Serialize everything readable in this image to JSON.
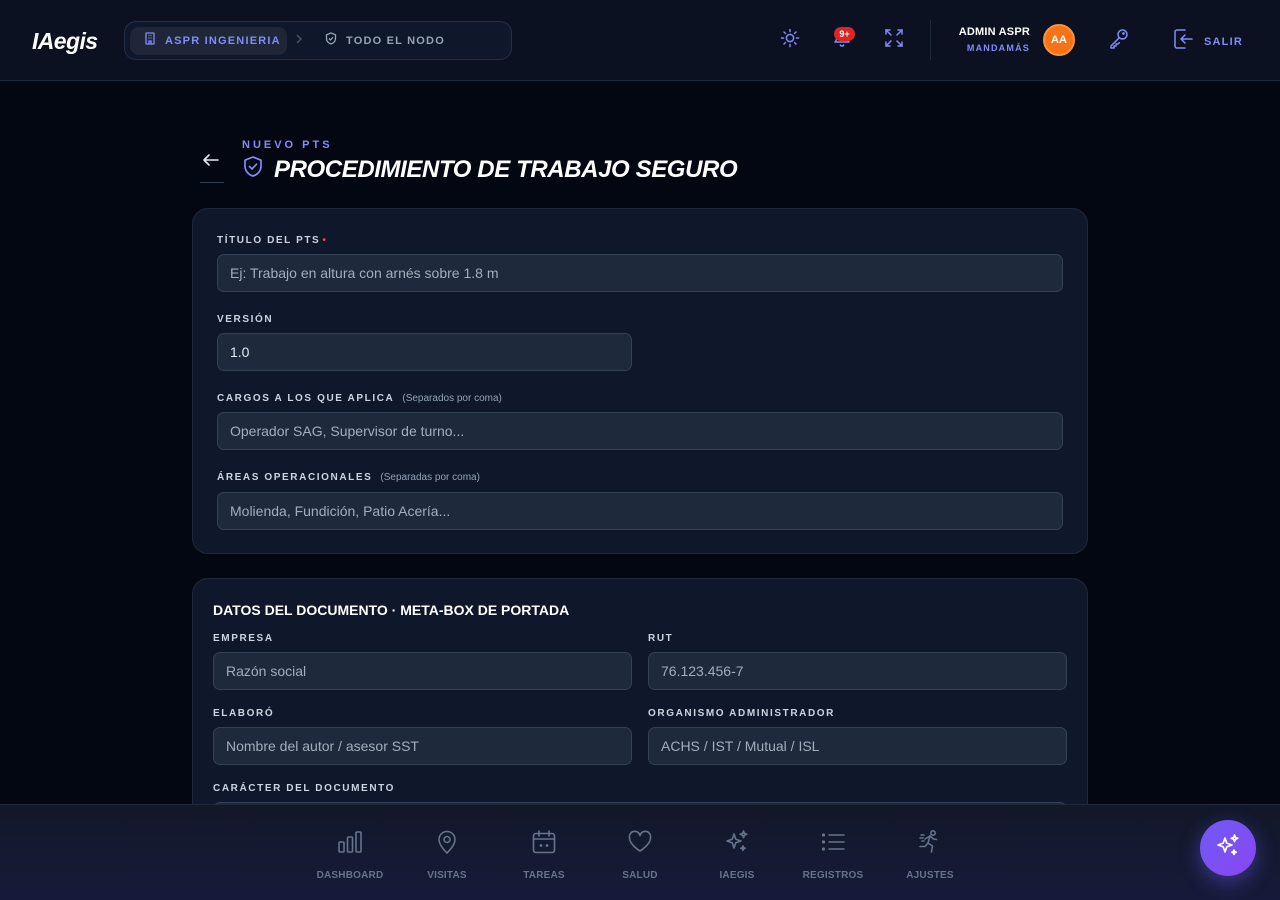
{
  "colors": {
    "accent": "#818cf8",
    "avatar_bg": "#f97316",
    "badge_bg": "#dc2626",
    "required": "#ef4444",
    "fab": "#7c4dfb"
  },
  "header": {
    "logo": "IAegis",
    "breadcrumb": {
      "active": "ASPR INGENIERIA",
      "active_icon": "building-icon",
      "secondary": "TODO EL NODO",
      "secondary_icon": "shield-icon"
    },
    "notifications_badge": "9+",
    "user": {
      "name": "ADMIN ASPR",
      "role": "MANDAMÁS",
      "initials": "AA"
    },
    "logout_label": "SALIR"
  },
  "page": {
    "eyebrow": "NUEVO PTS",
    "title": "PROCEDIMIENTO DE TRABAJO SEGURO"
  },
  "form": {
    "titulo": {
      "label": "TÍTULO DEL PTS",
      "required_mark": "•",
      "placeholder": "Ej: Trabajo en altura con arnés sobre 1.8 m"
    },
    "version": {
      "label": "VERSIÓN",
      "value": "1.0"
    },
    "cargos": {
      "label": "CARGOS A LOS QUE APLICA",
      "hint": "(Separados por coma)",
      "placeholder": "Operador SAG, Supervisor de turno..."
    },
    "areas": {
      "label": "ÁREAS OPERACIONALES",
      "hint": "(Separadas por coma)",
      "placeholder": "Molienda, Fundición, Patio Acería..."
    }
  },
  "document": {
    "title": "DATOS DEL DOCUMENTO · META-BOX DE PORTADA",
    "empresa": {
      "label": "EMPRESA",
      "placeholder": "Razón social"
    },
    "rut": {
      "label": "RUT",
      "placeholder": "76.123.456-7"
    },
    "elaboro": {
      "label": "ELABORÓ",
      "placeholder": "Nombre del autor / asesor SST"
    },
    "organismo": {
      "label": "ORGANISMO ADMINISTRADOR",
      "placeholder": "ACHS / IST / Mutual / ISL"
    },
    "caracter": {
      "label": "CARÁCTER DEL DOCUMENTO"
    }
  },
  "bottom_nav": [
    {
      "label": "DASHBOARD",
      "icon": "bar-chart-icon"
    },
    {
      "label": "VISITAS",
      "icon": "map-pin-icon"
    },
    {
      "label": "TAREAS",
      "icon": "calendar-icon"
    },
    {
      "label": "SALUD",
      "icon": "heart-icon"
    },
    {
      "label": "IAEGIS",
      "icon": "sparkles-icon"
    },
    {
      "label": "REGISTROS",
      "icon": "list-icon"
    },
    {
      "label": "AJUSTES",
      "icon": "running-person-icon"
    }
  ],
  "fab_icon": "sparkles-icon"
}
